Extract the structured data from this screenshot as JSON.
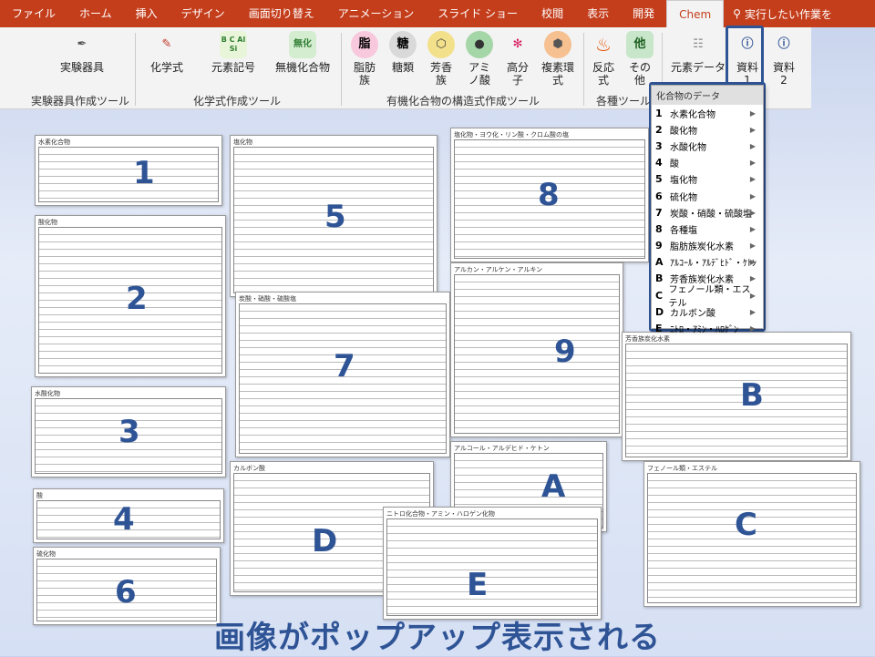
{
  "tabs": [
    "ファイル",
    "ホーム",
    "挿入",
    "デザイン",
    "画面切り替え",
    "アニメーション",
    "スライド ショー",
    "校閲",
    "表示",
    "開発",
    "Chem"
  ],
  "tell_me": "実行したい作業を",
  "ribbon": {
    "btn_lab": "実験器具",
    "group_lab": "実験器具作成ツール",
    "btn_formula": "化学式",
    "btn_symbol": "元素記号",
    "btn_inorg": "無機化合物",
    "group_formula": "化学式作成ツール",
    "btn_fat": "脂肪族",
    "btn_sugar": "糖類",
    "btn_arom": "芳香族",
    "btn_amino": "アミノ酸",
    "btn_poly": "高分子",
    "btn_ring": "複素環式",
    "group_org": "有機化合物の構造式作成ツール",
    "btn_react": "反応式",
    "btn_other": "その他",
    "group_misc": "各種ツール",
    "btn_elem": "元素データ",
    "btn_ref1": "資料 1",
    "btn_ref2": "資料 2",
    "icon_symbol": "B C Al Si",
    "icon_inorg": "無化",
    "icon_fat": "脂",
    "icon_sugar": "糖",
    "icon_other": "他"
  },
  "menu": {
    "title": "化合物のデータ",
    "items": [
      {
        "key": "1",
        "label": "水素化合物"
      },
      {
        "key": "2",
        "label": "酸化物"
      },
      {
        "key": "3",
        "label": "水酸化物"
      },
      {
        "key": "4",
        "label": "酸"
      },
      {
        "key": "5",
        "label": "塩化物"
      },
      {
        "key": "6",
        "label": "硫化物"
      },
      {
        "key": "7",
        "label": "炭酸・硝酸・硫酸塩"
      },
      {
        "key": "8",
        "label": "各種塩"
      },
      {
        "key": "9",
        "label": "脂肪族炭化水素"
      },
      {
        "key": "A",
        "label": "ｱﾙｺｰﾙ・ｱﾙﾃﾞﾋﾄﾞ・ｹﾄﾝ"
      },
      {
        "key": "B",
        "label": "芳香族炭化水素"
      },
      {
        "key": "C",
        "label": "フェノール類・エステル"
      },
      {
        "key": "D",
        "label": "カルボン酸"
      },
      {
        "key": "E",
        "label": "ﾆﾄﾛ・ｱﾐﾝ・ﾊﾛｹﾞﾝ"
      }
    ]
  },
  "thumbs": [
    {
      "title": "水素化合物",
      "num": "1"
    },
    {
      "title": "酸化物",
      "num": "2"
    },
    {
      "title": "水酸化物",
      "num": "3"
    },
    {
      "title": "酸",
      "num": "4"
    },
    {
      "title": "塩化物",
      "num": "5"
    },
    {
      "title": "硫化物",
      "num": "6"
    },
    {
      "title": "炭酸・硝酸・硫酸塩",
      "num": "7"
    },
    {
      "title": "塩化物・ヨウ化・リン酸・クロム酸の塩",
      "num": "8"
    },
    {
      "title": "アルカン・アルケン・アルキン",
      "num": "9"
    },
    {
      "title": "アルコール・アルデヒド・ケトン",
      "num": "A"
    },
    {
      "title": "芳香族炭化水素",
      "num": "B"
    },
    {
      "title": "フェノール類・エステル",
      "num": "C"
    },
    {
      "title": "カルボン酸",
      "num": "D"
    },
    {
      "title": "ニトロ化合物・アミン・ハロゲン化物",
      "num": "E"
    }
  ],
  "caption": "画像がポップアップ表示される"
}
